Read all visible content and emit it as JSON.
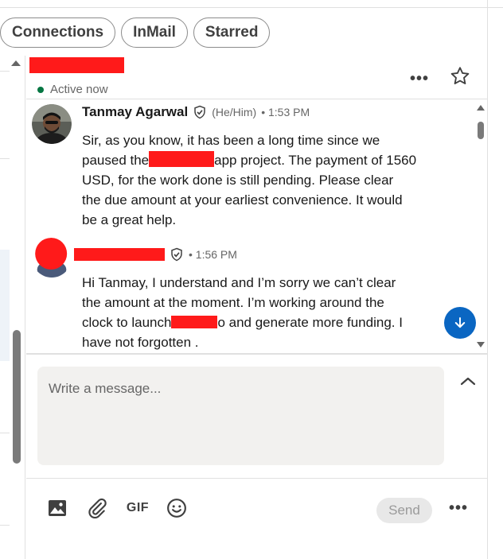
{
  "filters": [
    {
      "label": "Connections"
    },
    {
      "label": "InMail"
    },
    {
      "label": "Starred"
    }
  ],
  "header": {
    "status": "Active now",
    "more_label": "•••",
    "star_icon": "star-outline-icon",
    "presence_color": "#057642"
  },
  "messages": [
    {
      "sender": "Tanmay Agarwal",
      "pronouns": "(He/Him)",
      "time": "• 1:53 PM",
      "lines": [
        "Sir, as you know, it has been a long time since we",
        "paused the",
        "app project. The payment of 1560",
        "USD, for the work done is still pending. Please clear",
        "the due amount at your earliest convenience. It would",
        "be a great help."
      ]
    },
    {
      "sender": "",
      "time": "• 1:56 PM",
      "lines": [
        "Hi Tanmay, I understand and I’m sorry we can’t clear",
        "the amount at the moment. I’m working around the",
        "clock to launch",
        "o and generate more funding. I",
        "have not forgotten ."
      ]
    }
  ],
  "composer": {
    "placeholder": "Write a message...",
    "gif_label": "GIF",
    "send_label": "Send",
    "more_label": "•••"
  },
  "colors": {
    "accent": "#0a66c2",
    "redaction": "#ff1a1a"
  }
}
